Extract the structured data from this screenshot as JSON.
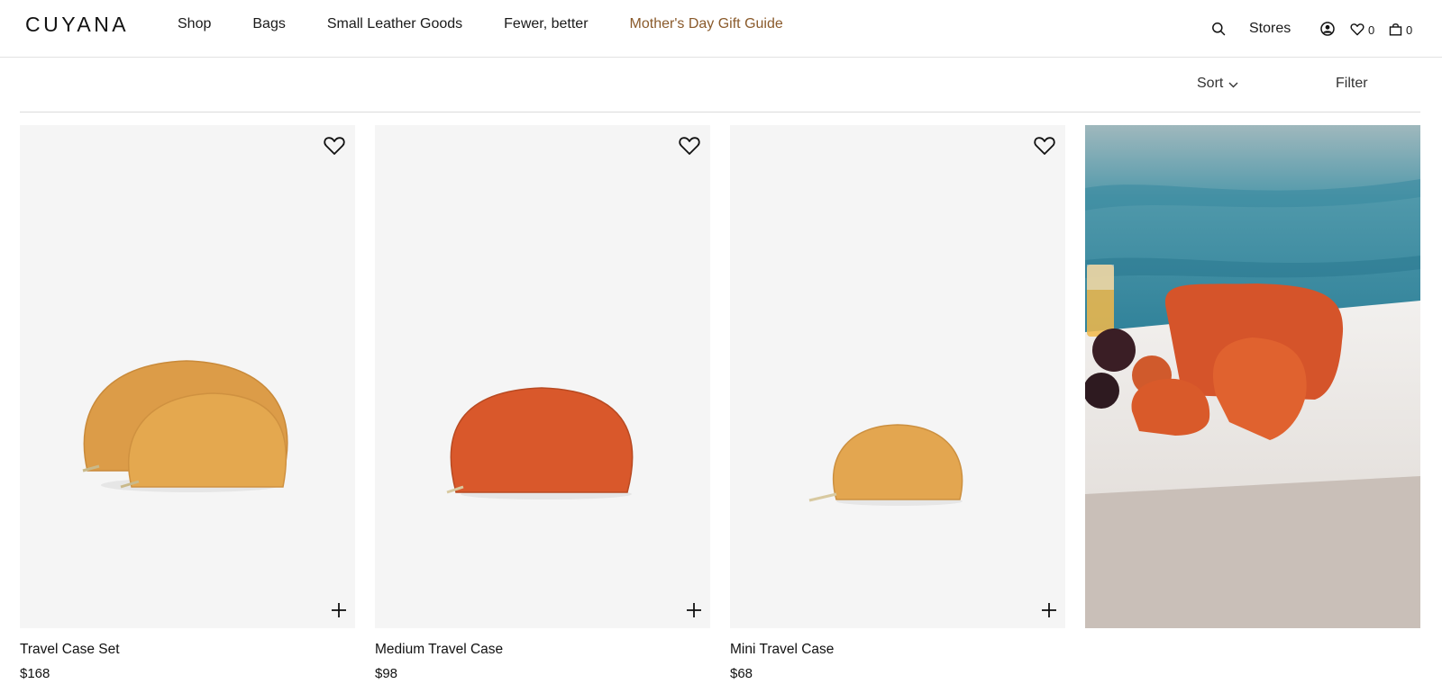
{
  "header": {
    "logo": "CUYANA",
    "nav": [
      {
        "label": "Shop"
      },
      {
        "label": "Bags"
      },
      {
        "label": "Small Leather Goods"
      },
      {
        "label": "Fewer, better"
      },
      {
        "label": "Mother's Day Gift Guide",
        "accent": true
      }
    ],
    "stores_label": "Stores",
    "wishlist_count": "0",
    "cart_count": "0",
    "icons": [
      "search-icon",
      "account-icon",
      "heart-icon",
      "bag-icon"
    ]
  },
  "toolbar": {
    "sort_label": "Sort",
    "filter_label": "Filter"
  },
  "products": [
    {
      "name": "Travel Case Set",
      "price": "$168",
      "color": "#e0a04e"
    },
    {
      "name": "Medium Travel Case",
      "price": "$98",
      "color": "#d95a2a"
    },
    {
      "name": "Mini Travel Case",
      "price": "$68",
      "color": "#e3a650"
    }
  ],
  "colors": {
    "accent_nav": "#8a5a2b",
    "card_bg": "#f5f5f5",
    "divider": "#e2e2e2"
  }
}
